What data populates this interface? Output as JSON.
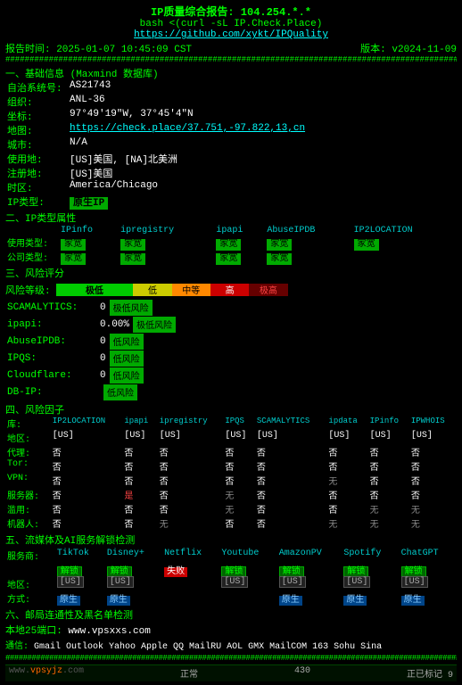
{
  "header": {
    "title": "IP质量综合报告: 104.254.*.*",
    "cmd": "bash <(curl -sL IP.Check.Place)",
    "github_url": "https://github.com/xykt/IPQuality",
    "report_time": "报告时间: 2025-01-07 10:45:09 CST",
    "tool_version": "版本: v2024-11-09"
  },
  "hash_line": "########################################################################################################",
  "sections": {
    "basic_info": {
      "title": "一、基础信息 (Maxmind 数据库)",
      "fields": {
        "asn": {
          "label": "自治系统号:",
          "value": "AS21743"
        },
        "org": {
          "label": "组织:",
          "value": "ANL-36"
        },
        "location": {
          "label": "坐标:",
          "value": "97°49'19\"W, 37°45'4\"N"
        },
        "map": {
          "label": "地图:",
          "value": "https://check.place/37.751,-97.822,13,cn",
          "is_link": true
        },
        "city": {
          "label": "城市:",
          "value": "N/A"
        },
        "usage": {
          "label": "使用地:",
          "value": "[US]美国, [NA]北美洲"
        },
        "reg": {
          "label": "注册地:",
          "value": "[US]美国"
        },
        "timezone": {
          "label": "时区:",
          "value": "America/Chicago"
        },
        "ip_type": {
          "label": "IP类型:",
          "value": "原生IP",
          "highlighted": true
        }
      }
    },
    "ip_type": {
      "title": "二、IP类型属性",
      "col_headers": [
        "",
        "IPinfo",
        "ipregistry",
        "ipapi",
        "AbuseIPDB",
        "IP2LOCATION"
      ],
      "rows": {
        "usage_type": {
          "label": "使用类型:",
          "values": [
            "家宽",
            "家宽",
            "家宽",
            "家宽",
            "家宽"
          ]
        },
        "company_type": {
          "label": "公司类型:",
          "values": [
            "家宽",
            "家宽",
            "家宽",
            "家宽",
            ""
          ]
        }
      }
    },
    "risk_score": {
      "title": "三、风险评分",
      "risk_level_label": "风险等级:",
      "risk_levels": [
        "极低",
        "低",
        "中等",
        "高",
        "极高"
      ],
      "items": [
        {
          "label": "SCAMALYTICS:",
          "score": "0",
          "text": "极低风险"
        },
        {
          "label": "ipapi:",
          "score": "0.00%",
          "text": "极低风险"
        },
        {
          "label": "AbuseIPDB:",
          "score": "0",
          "text": "低风险"
        },
        {
          "label": "IPQS:",
          "score": "0",
          "text": "低风险"
        },
        {
          "label": "Cloudflare:",
          "score": "0",
          "text": "低风险"
        },
        {
          "label": "DB-IP:",
          "score": "",
          "text": "低风险"
        }
      ]
    },
    "risk_factors": {
      "title": "四、风险因子",
      "col_headers": [
        "库:",
        "IP2LOCATION",
        "ipapi",
        "ipregistry",
        "IPQS",
        "SCAMALYTICS",
        "ipdata",
        "IPinfo",
        "IPWHOIS"
      ],
      "rows": [
        {
          "label": "地区:",
          "values": [
            "[US]",
            "[US]",
            "[US]",
            "[US]",
            "[US]",
            "[US]",
            "[US]",
            "[US]"
          ]
        },
        {
          "label": "代理:",
          "values": [
            "否",
            "否",
            "否",
            "否",
            "否",
            "否",
            "否",
            "否"
          ]
        },
        {
          "label": "Tor:",
          "values": [
            "否",
            "否",
            "否",
            "否",
            "否",
            "否",
            "否",
            "否"
          ]
        },
        {
          "label": "VPN:",
          "values": [
            "否",
            "否",
            "否",
            "否",
            "否",
            "无",
            "否",
            "否"
          ]
        },
        {
          "label": "服务器:",
          "values": [
            "否",
            "是",
            "否",
            "无",
            "否",
            "否",
            "否",
            "否"
          ]
        },
        {
          "label": "滥用:",
          "values": [
            "否",
            "否",
            "否",
            "无",
            "否",
            "否",
            "无",
            "无"
          ]
        },
        {
          "label": "机器人:",
          "values": [
            "否",
            "否",
            "无",
            "否",
            "否",
            "无",
            "无",
            "无"
          ]
        }
      ]
    },
    "streaming": {
      "title": "五、流媒体及AI服务解锁检测",
      "services": [
        "TikTok",
        "Disney+",
        "Netflix",
        "Youtube",
        "AmazonPV",
        "Spotify",
        "ChatGPT"
      ],
      "status": [
        "解锁",
        "解锁",
        "失败",
        "解锁",
        "解锁",
        "解锁",
        "解锁"
      ],
      "regions": [
        "[US]",
        "[US]",
        "",
        "[US]",
        "[US]",
        "[US]",
        "[US]"
      ],
      "methods": [
        "原生",
        "原生",
        "",
        "",
        "原生",
        "原生",
        "原生"
      ]
    },
    "email": {
      "title": "六、邮局连通性及黑名单检测",
      "port_label": "本地25端口:",
      "port_value": "www.vpsxxs.com",
      "providers": [
        "Gmail",
        "Outlook",
        "Yahoo",
        "Apple",
        "QQ",
        "MailRU",
        "AOL",
        "GMX",
        "MailCOM",
        "163",
        "Sohu",
        "Sina"
      ]
    }
  },
  "status_bar": {
    "items": [
      {
        "label": "www",
        "value": "正常"
      },
      {
        "label": "430",
        "value": ""
      },
      {
        "label": "正在标记 9",
        "value": ""
      }
    ],
    "bottom_text": "www.vpsyz.com"
  }
}
